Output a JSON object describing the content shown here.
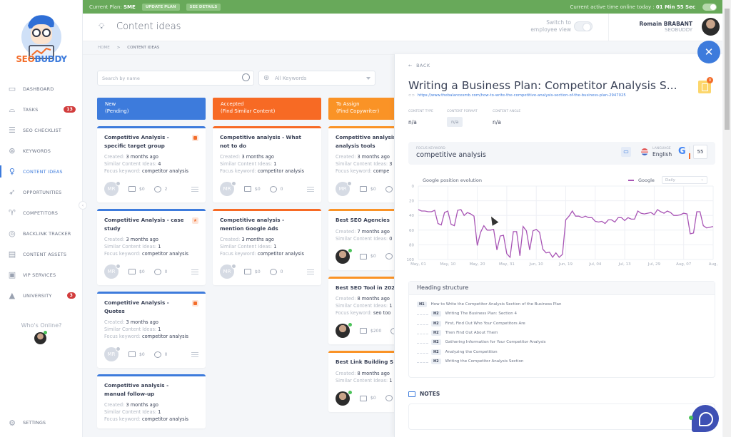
{
  "app": {
    "brand_part1": "SEO",
    "brand_part2": "BUDDY"
  },
  "topbar": {
    "plan_label": "Current Plan:",
    "plan_value": "SME",
    "update_plan": "UPDATE PLAN",
    "see_details": "SEE DETAILS",
    "online_label": "Current active time online today :",
    "online_value": "01 Min 55 Sec"
  },
  "header": {
    "title": "Content ideas",
    "switch_label_1": "Switch to",
    "switch_label_2": "employee view",
    "user_name": "Romain BRABANT",
    "user_org": "SEOBUDDY"
  },
  "breadcrumb": {
    "home": "HOME",
    "separator": ">",
    "current": "CONTENT IDEAS"
  },
  "sidebar": {
    "items": [
      {
        "label": "DASHBOARD",
        "icon": "monitor-icon"
      },
      {
        "label": "TASKS",
        "icon": "mouse-icon",
        "badge": "13"
      },
      {
        "label": "SEO CHECKLIST",
        "icon": "list-icon"
      },
      {
        "label": "KEYWORDS",
        "icon": "target-icon"
      },
      {
        "label": "CONTENT IDEAS",
        "icon": "bulb-icon",
        "active": true
      },
      {
        "label": "OPPORTUNITIES",
        "icon": "rocket-icon"
      },
      {
        "label": "COMPETITORS",
        "icon": "trophy-icon"
      },
      {
        "label": "BACKLINK TRACKER",
        "icon": "radar-icon"
      },
      {
        "label": "CONTENT ASSETS",
        "icon": "clipboard-icon"
      },
      {
        "label": "VIP SERVICES",
        "icon": "card-icon"
      },
      {
        "label": "UNIVERSITY",
        "icon": "graduation-cap-icon",
        "badge": "3"
      }
    ],
    "whos_online": "Who's Online?",
    "settings": "SETTINGS"
  },
  "filters": {
    "search_placeholder": "Search by name",
    "keywords_select": "All Keywords"
  },
  "labels": {
    "created": "Created:",
    "similar": "Similar Content Ideas:",
    "focus": "Focus keyword:"
  },
  "columns": [
    {
      "title": "New",
      "subtitle": "(Pending)",
      "color": "#3d7bdc",
      "cards": [
        {
          "title": "Competitive Analysis - specific target group",
          "created": "3 months ago",
          "similar": "4",
          "focus": "competitor analysis",
          "avatar": "MR",
          "budget": "$0",
          "comments": "2",
          "flag": "square"
        },
        {
          "title": "Competitive Analysis - case study",
          "created": "3 months ago",
          "similar": "1",
          "focus": "competitor analysis",
          "avatar": "MR",
          "budget": "$0",
          "comments": "0",
          "flag": "star"
        },
        {
          "title": "Competitive Analysis - Quotes",
          "created": "3 months ago",
          "similar": "1",
          "focus": "competitor analysis",
          "avatar": "MR",
          "budget": "$0",
          "comments": "0",
          "flag": "square"
        },
        {
          "title": "Competitive analysis - manual follow-up",
          "created": "3 months ago",
          "similar": "1",
          "focus": "competitor analysis"
        }
      ]
    },
    {
      "title": "Accepted",
      "subtitle": "(Find Similar Content)",
      "color": "#f76a24",
      "cards": [
        {
          "title": "Competitive analysis - What not to do",
          "created": "3 months ago",
          "similar": "1",
          "focus": "competitor analysis",
          "avatar": "MR",
          "budget": "$0",
          "comments": "0"
        },
        {
          "title": "Competitive analysis - mention Google Ads",
          "created": "3 months ago",
          "similar": "1",
          "focus": "competitor analysis",
          "avatar": "MR",
          "budget": "$0",
          "comments": "0"
        }
      ]
    },
    {
      "title": "To Assign",
      "subtitle": "(Find Copywriter)",
      "color": "#fa9326",
      "cards": [
        {
          "title": "Competitive analysis analysis tools",
          "created": "3 months ago",
          "similar": "3",
          "focus": "compe",
          "avatar": "MR",
          "budget": "$0"
        },
        {
          "title": "Best SEO Agencies",
          "created": "7 months ago",
          "similar": "0",
          "avatar": "photo",
          "budget": "$0"
        },
        {
          "title": "Best SEO Tool in 202",
          "created": "8 months ago",
          "similar": "1",
          "focus": "seo too",
          "avatar": "photo",
          "budget": "$200"
        },
        {
          "title": "Best Link Building S",
          "created": "8 months ago",
          "similar": "1",
          "avatar": "photo",
          "budget": "$0"
        }
      ]
    }
  ],
  "panel": {
    "back": "BACK",
    "title": "Writing a Business Plan: Competitor Analysis S...",
    "url": "https://www.thebalancesmb.com/how-to-write-the-competitive-analysis-section-of-the-business-plan-2947025",
    "badge_count": "0",
    "content_type_label": "CONTENT TYPE",
    "content_type": "n/a",
    "content_format_label": "CONTENT FORMAT",
    "content_format": "n/a",
    "content_angle_label": "CONTENT ANGLE",
    "content_angle": "n/a",
    "focus_label": "FOCUS KEYWORD",
    "focus_value": "competitive analysis",
    "language_label": "LANGUAGE",
    "language": "English",
    "score": "55",
    "chart_select": "Daily",
    "heading_title": "Heading structure",
    "headings": [
      {
        "tag": "H1",
        "text": "How to Write the Competitor Analysis Section of the Business Plan"
      },
      {
        "tag": "H2",
        "text": "Writing The Business Plan: Section 4"
      },
      {
        "tag": "H2",
        "text": "First, Find Out Who Your Competitors Are"
      },
      {
        "tag": "H2",
        "text": "Then Find Out About Them"
      },
      {
        "tag": "H2",
        "text": "Gathering Information for Your Competitor Analysis"
      },
      {
        "tag": "H2",
        "text": "Analyzing the Competition"
      },
      {
        "tag": "H2",
        "text": "Writing the Competitor Analysis Section"
      }
    ],
    "notes": "NOTES"
  },
  "chart_data": {
    "type": "line",
    "title": "Google position evolution",
    "legend": [
      "Google"
    ],
    "legend_position": "top-right",
    "series_color": "#a855b5",
    "x_tick_labels": [
      "May, 01",
      "May, 10",
      "May, 20",
      "May, 31",
      "Jun, 10",
      "Jun, 19",
      "Jul, 04",
      "Jul, 13",
      "Jul, 29",
      "Aug, 07",
      "Aug,"
    ],
    "y_ticks": [
      0,
      20,
      40,
      60,
      80,
      100
    ],
    "ylim": [
      0,
      100
    ],
    "y_inverted": true,
    "grid": true,
    "series": [
      {
        "name": "Google",
        "values": [
          32,
          34,
          34,
          35,
          35,
          33,
          51,
          53,
          36,
          34,
          52,
          54,
          33,
          32,
          40,
          36,
          38,
          41,
          81,
          63,
          54,
          60,
          60,
          59,
          87,
          68,
          67,
          92,
          97,
          62,
          62,
          95,
          55,
          61,
          87,
          61,
          59,
          63,
          86,
          91,
          90,
          97,
          91,
          97,
          93,
          46,
          41,
          34,
          41,
          41,
          43,
          41,
          43,
          43,
          48,
          49,
          48,
          51,
          46,
          46,
          49,
          43,
          43,
          47,
          43,
          45,
          45,
          34,
          37,
          38,
          37,
          36,
          39,
          32,
          35,
          37,
          34,
          36,
          40,
          40,
          39,
          37,
          38,
          65,
          64,
          35,
          35,
          54,
          57,
          56,
          55
        ]
      }
    ]
  }
}
